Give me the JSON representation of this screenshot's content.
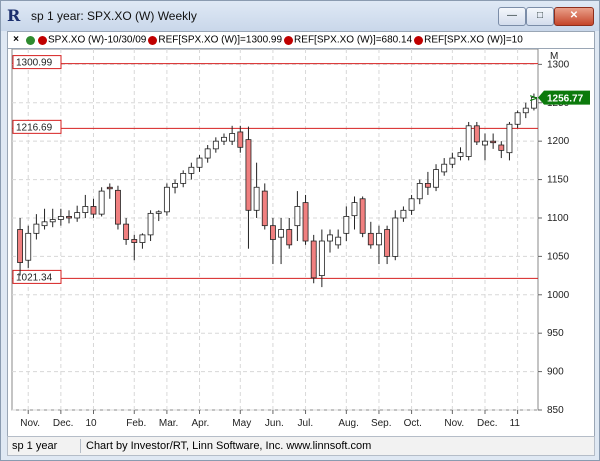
{
  "window": {
    "title": "sp 1 year: SPX.XO (W) Weekly",
    "minimize_label": "—",
    "maximize_label": "□",
    "close_label": "✕"
  },
  "legend": {
    "close_glyph": "×",
    "items": [
      {
        "label": "SPX.XO (W)-10/30/09",
        "dots": [
          "#2e8b2e",
          "#c00000"
        ]
      },
      {
        "label": "REF[SPX.XO (W)]=1300.99",
        "dots": [
          "#c00000"
        ]
      },
      {
        "label": "REF[SPX.XO (W)]=680.14",
        "dots": [
          "#c00000"
        ]
      },
      {
        "label": "REF[SPX.XO (W)]=10",
        "dots": [
          "#c00000"
        ]
      }
    ]
  },
  "status": {
    "left": "sp 1 year",
    "right": "Chart by Investor/RT, Linn Software, Inc. www.linnsoft.com"
  },
  "colors": {
    "up_candle": "#ffffff",
    "down_candle": "#f08080",
    "ref_line": "#d62020",
    "last_price_bg": "#0c7a0c",
    "grid": "#d8d8d8"
  },
  "chart_data": {
    "type": "candlestick",
    "ylim": [
      850,
      1320
    ],
    "y_ticks": [
      850,
      900,
      950,
      1000,
      1050,
      1100,
      1150,
      1200,
      1250,
      1300
    ],
    "x_tick_labels": [
      "Nov.",
      "Dec.",
      "10",
      "Feb.",
      "Mar.",
      "Apr.",
      "May",
      "Jun.",
      "Jul.",
      "Aug.",
      "Sep.",
      "Oct.",
      "Nov.",
      "Dec.",
      "11"
    ],
    "x_tick_weeks": [
      1.5,
      5.5,
      9.5,
      14.5,
      18.5,
      22.5,
      27.5,
      31.5,
      35.5,
      40.5,
      44.5,
      48.5,
      53.5,
      57.5,
      61.5
    ],
    "reference_lines": [
      {
        "value": 1300.99,
        "label": "1300.99"
      },
      {
        "value": 1216.69,
        "label": "1216.69"
      },
      {
        "value": 1021.34,
        "label": "1021.34"
      }
    ],
    "last_price": {
      "value": 1256.77,
      "label": "1256.77"
    },
    "scale_corner_label": "M",
    "candles": [
      {
        "o": 1085,
        "h": 1100,
        "l": 1025,
        "c": 1042
      },
      {
        "o": 1045,
        "h": 1090,
        "l": 1035,
        "c": 1080
      },
      {
        "o": 1080,
        "h": 1105,
        "l": 1072,
        "c": 1092
      },
      {
        "o": 1090,
        "h": 1112,
        "l": 1085,
        "c": 1095
      },
      {
        "o": 1095,
        "h": 1112,
        "l": 1088,
        "c": 1098
      },
      {
        "o": 1098,
        "h": 1112,
        "l": 1090,
        "c": 1102
      },
      {
        "o": 1102,
        "h": 1110,
        "l": 1093,
        "c": 1100
      },
      {
        "o": 1100,
        "h": 1116,
        "l": 1095,
        "c": 1107
      },
      {
        "o": 1107,
        "h": 1130,
        "l": 1100,
        "c": 1115
      },
      {
        "o": 1115,
        "h": 1125,
        "l": 1100,
        "c": 1105
      },
      {
        "o": 1105,
        "h": 1140,
        "l": 1102,
        "c": 1135
      },
      {
        "o": 1140,
        "h": 1145,
        "l": 1125,
        "c": 1138
      },
      {
        "o": 1136,
        "h": 1142,
        "l": 1085,
        "c": 1092
      },
      {
        "o": 1092,
        "h": 1100,
        "l": 1065,
        "c": 1072
      },
      {
        "o": 1072,
        "h": 1078,
        "l": 1045,
        "c": 1068
      },
      {
        "o": 1068,
        "h": 1080,
        "l": 1060,
        "c": 1078
      },
      {
        "o": 1078,
        "h": 1110,
        "l": 1070,
        "c": 1106
      },
      {
        "o": 1106,
        "h": 1110,
        "l": 1096,
        "c": 1108
      },
      {
        "o": 1108,
        "h": 1145,
        "l": 1103,
        "c": 1140
      },
      {
        "o": 1140,
        "h": 1150,
        "l": 1132,
        "c": 1145
      },
      {
        "o": 1145,
        "h": 1162,
        "l": 1140,
        "c": 1158
      },
      {
        "o": 1158,
        "h": 1172,
        "l": 1150,
        "c": 1166
      },
      {
        "o": 1166,
        "h": 1182,
        "l": 1160,
        "c": 1178
      },
      {
        "o": 1178,
        "h": 1195,
        "l": 1172,
        "c": 1190
      },
      {
        "o": 1190,
        "h": 1205,
        "l": 1185,
        "c": 1200
      },
      {
        "o": 1200,
        "h": 1210,
        "l": 1195,
        "c": 1205
      },
      {
        "o": 1200,
        "h": 1220,
        "l": 1195,
        "c": 1210
      },
      {
        "o": 1212,
        "h": 1220,
        "l": 1185,
        "c": 1192
      },
      {
        "o": 1202,
        "h": 1219,
        "l": 1060,
        "c": 1110
      },
      {
        "o": 1110,
        "h": 1172,
        "l": 1100,
        "c": 1140
      },
      {
        "o": 1135,
        "h": 1145,
        "l": 1085,
        "c": 1090
      },
      {
        "o": 1090,
        "h": 1100,
        "l": 1040,
        "c": 1072
      },
      {
        "o": 1075,
        "h": 1100,
        "l": 1040,
        "c": 1085
      },
      {
        "o": 1085,
        "h": 1100,
        "l": 1060,
        "c": 1065
      },
      {
        "o": 1090,
        "h": 1135,
        "l": 1070,
        "c": 1115
      },
      {
        "o": 1120,
        "h": 1130,
        "l": 1065,
        "c": 1070
      },
      {
        "o": 1070,
        "h": 1078,
        "l": 1015,
        "c": 1022
      },
      {
        "o": 1025,
        "h": 1085,
        "l": 1010,
        "c": 1070
      },
      {
        "o": 1070,
        "h": 1085,
        "l": 1055,
        "c": 1078
      },
      {
        "o": 1065,
        "h": 1085,
        "l": 1060,
        "c": 1075
      },
      {
        "o": 1080,
        "h": 1115,
        "l": 1070,
        "c": 1102
      },
      {
        "o": 1103,
        "h": 1128,
        "l": 1085,
        "c": 1120
      },
      {
        "o": 1125,
        "h": 1128,
        "l": 1075,
        "c": 1080
      },
      {
        "o": 1080,
        "h": 1095,
        "l": 1060,
        "c": 1065
      },
      {
        "o": 1065,
        "h": 1090,
        "l": 1040,
        "c": 1080
      },
      {
        "o": 1085,
        "h": 1090,
        "l": 1040,
        "c": 1050
      },
      {
        "o": 1050,
        "h": 1110,
        "l": 1045,
        "c": 1100
      },
      {
        "o": 1100,
        "h": 1115,
        "l": 1095,
        "c": 1110
      },
      {
        "o": 1110,
        "h": 1130,
        "l": 1104,
        "c": 1125
      },
      {
        "o": 1125,
        "h": 1150,
        "l": 1118,
        "c": 1145
      },
      {
        "o": 1145,
        "h": 1160,
        "l": 1130,
        "c": 1140
      },
      {
        "o": 1140,
        "h": 1170,
        "l": 1135,
        "c": 1163
      },
      {
        "o": 1160,
        "h": 1178,
        "l": 1155,
        "c": 1170
      },
      {
        "o": 1170,
        "h": 1185,
        "l": 1165,
        "c": 1178
      },
      {
        "o": 1180,
        "h": 1192,
        "l": 1175,
        "c": 1185
      },
      {
        "o": 1180,
        "h": 1225,
        "l": 1175,
        "c": 1220
      },
      {
        "o": 1220,
        "h": 1225,
        "l": 1195,
        "c": 1199
      },
      {
        "o": 1195,
        "h": 1210,
        "l": 1175,
        "c": 1200
      },
      {
        "o": 1200,
        "h": 1210,
        "l": 1190,
        "c": 1198
      },
      {
        "o": 1195,
        "h": 1200,
        "l": 1178,
        "c": 1188
      },
      {
        "o": 1185,
        "h": 1225,
        "l": 1175,
        "c": 1222
      },
      {
        "o": 1222,
        "h": 1240,
        "l": 1217,
        "c": 1237
      },
      {
        "o": 1237,
        "h": 1250,
        "l": 1230,
        "c": 1243
      },
      {
        "o": 1243,
        "h": 1262,
        "l": 1240,
        "c": 1257
      }
    ]
  }
}
